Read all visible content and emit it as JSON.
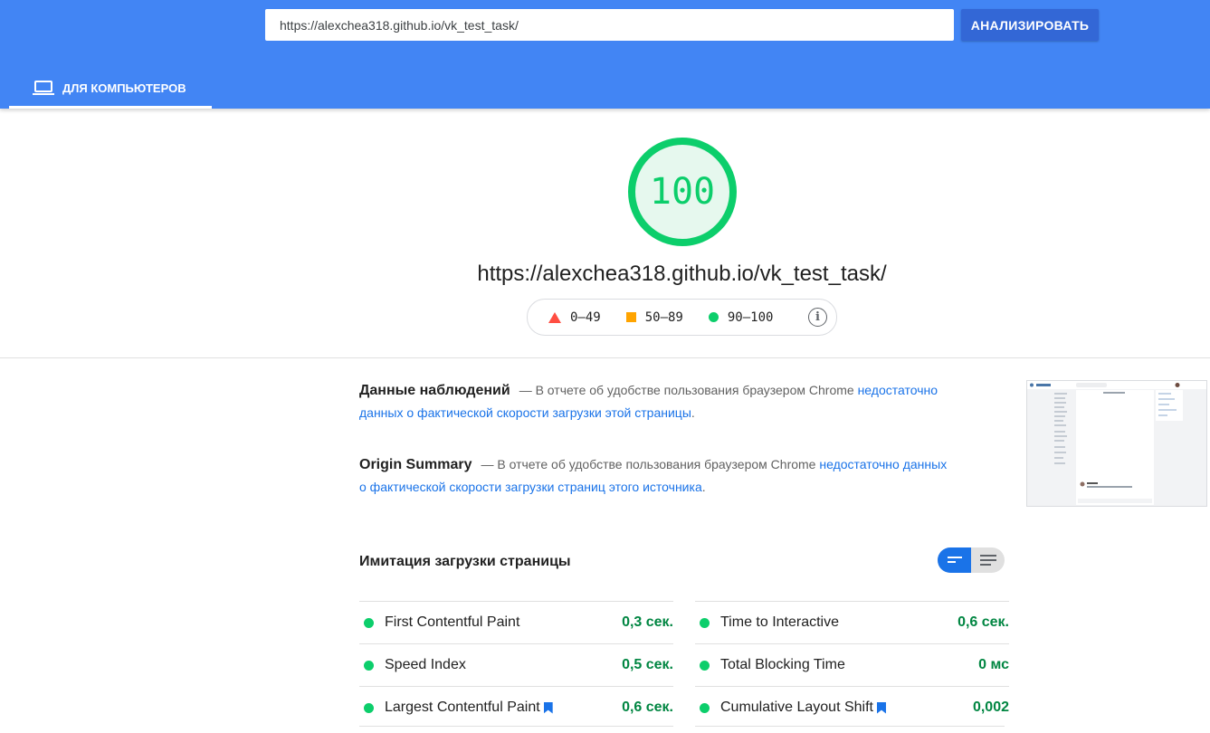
{
  "header": {
    "url_value": "https://alexchea318.github.io/vk_test_task/",
    "analyze_label": "АНАЛИЗИРОВАТЬ",
    "tab_label": "ДЛЯ КОМПЬЮТЕРОВ",
    "tab_icon": "laptop-icon",
    "color": "#4285f4"
  },
  "score": {
    "value": "100",
    "color": "#0cce6b"
  },
  "page_url": "https://alexchea318.github.io/vk_test_task/",
  "legend": [
    {
      "label": "0–49",
      "icon": "red-triangle",
      "color": "#ff4e42"
    },
    {
      "label": "50–89",
      "icon": "orange-square",
      "color": "#ffa400"
    },
    {
      "label": "90–100",
      "icon": "green-circle",
      "color": "#0cce6b"
    }
  ],
  "field_data": {
    "title": "Данные наблюдений",
    "text_prefix": "— В отчете об удобстве пользования браузером Chrome ",
    "link_text": "недостаточно данных о фактической скорости загрузки этой страницы",
    "text_suffix": "."
  },
  "origin_summary": {
    "title": "Origin Summary",
    "text_prefix": "— В отчете об удобстве пользования браузером Chrome ",
    "link_text": "недостаточно данных о фактической скорости загрузки страниц этого источника",
    "text_suffix": "."
  },
  "lab": {
    "title": "Имитация загрузки страницы",
    "metrics": [
      {
        "name": "First Contentful Paint",
        "value": "0,3 сек.",
        "bookmark": false
      },
      {
        "name": "Time to Interactive",
        "value": "0,6 сек.",
        "bookmark": false
      },
      {
        "name": "Speed Index",
        "value": "0,5 сек.",
        "bookmark": false
      },
      {
        "name": "Total Blocking Time",
        "value": "0 мс",
        "bookmark": false
      },
      {
        "name": "Largest Contentful Paint",
        "value": "0,6 сек.",
        "bookmark": true
      },
      {
        "name": "Cumulative Layout Shift",
        "value": "0,002",
        "bookmark": true
      }
    ]
  }
}
